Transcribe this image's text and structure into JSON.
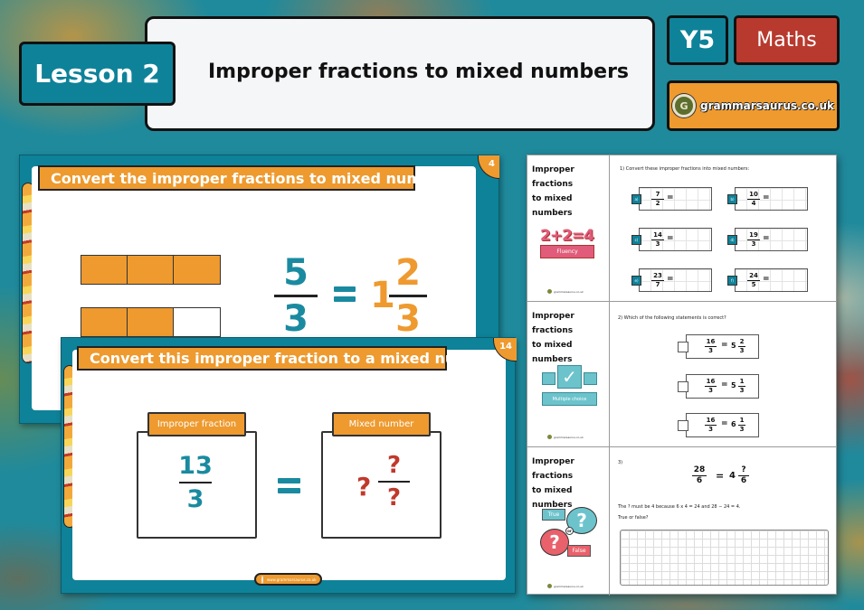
{
  "header": {
    "lesson_label": "Lesson 2",
    "title": "Improper fractions to mixed numbers",
    "year_badge": "Y5",
    "subject_badge": "Maths",
    "brand_url": "grammarsaurus.co.uk",
    "brand_logo_letter": "G"
  },
  "colors": {
    "teal": "#0e8299",
    "orange": "#ee9a2f",
    "red": "#b83a2e"
  },
  "slide_back": {
    "number": "4",
    "title": "Convert the improper fractions to mixed numbers",
    "bar_model": [
      [
        "filled",
        "filled",
        "filled"
      ],
      [
        "filled",
        "filled",
        "empty"
      ]
    ],
    "improper": {
      "numerator": "5",
      "denominator": "3"
    },
    "mixed": {
      "whole": "1",
      "numerator": "2",
      "denominator": "3"
    }
  },
  "slide_front": {
    "number": "14",
    "title": "Convert this improper fraction to a mixed number",
    "left_label": "Improper fraction",
    "right_label": "Mixed number",
    "improper": {
      "numerator": "13",
      "denominator": "3"
    },
    "mixed": {
      "whole": "?",
      "numerator": "?",
      "denominator": "?"
    },
    "footer_url": "www.grammarsaurus.co.uk"
  },
  "worksheet": {
    "section_title_line1": "Improper fractions",
    "section_title_line2": "to mixed numbers",
    "footer_url": "grammarsaurus.co.uk",
    "fluency": {
      "icon_equation": "2+2=4",
      "icon_label": "Fluency",
      "question": "1) Convert these improper fractions into mixed numbers:",
      "items": [
        {
          "tag": "a)",
          "numerator": "7",
          "denominator": "2"
        },
        {
          "tag": "b)",
          "numerator": "10",
          "denominator": "4"
        },
        {
          "tag": "c)",
          "numerator": "14",
          "denominator": "3"
        },
        {
          "tag": "d)",
          "numerator": "19",
          "denominator": "3"
        },
        {
          "tag": "e)",
          "numerator": "23",
          "denominator": "7"
        },
        {
          "tag": "f)",
          "numerator": "24",
          "denominator": "5"
        }
      ],
      "equals": "="
    },
    "multiple_choice": {
      "icon_label": "Multiple choice",
      "question": "2) Which of the following statements is correct?",
      "options": [
        {
          "numerator": "16",
          "denominator": "3",
          "whole": "5",
          "m_num": "2",
          "m_den": "3"
        },
        {
          "numerator": "16",
          "denominator": "3",
          "whole": "5",
          "m_num": "1",
          "m_den": "3"
        },
        {
          "numerator": "16",
          "denominator": "3",
          "whole": "6",
          "m_num": "1",
          "m_den": "3"
        }
      ]
    },
    "true_false": {
      "icon_true": "True",
      "icon_false": "False",
      "icon_or": "or",
      "question_number": "3)",
      "equation": {
        "numerator": "28",
        "denominator": "6",
        "whole": "4",
        "m_num": "?",
        "m_den": "6"
      },
      "statement": "The ? must be 4 because 6 x 4 = 24 and 28 − 24 = 4.",
      "prompt": "True or false?"
    }
  }
}
